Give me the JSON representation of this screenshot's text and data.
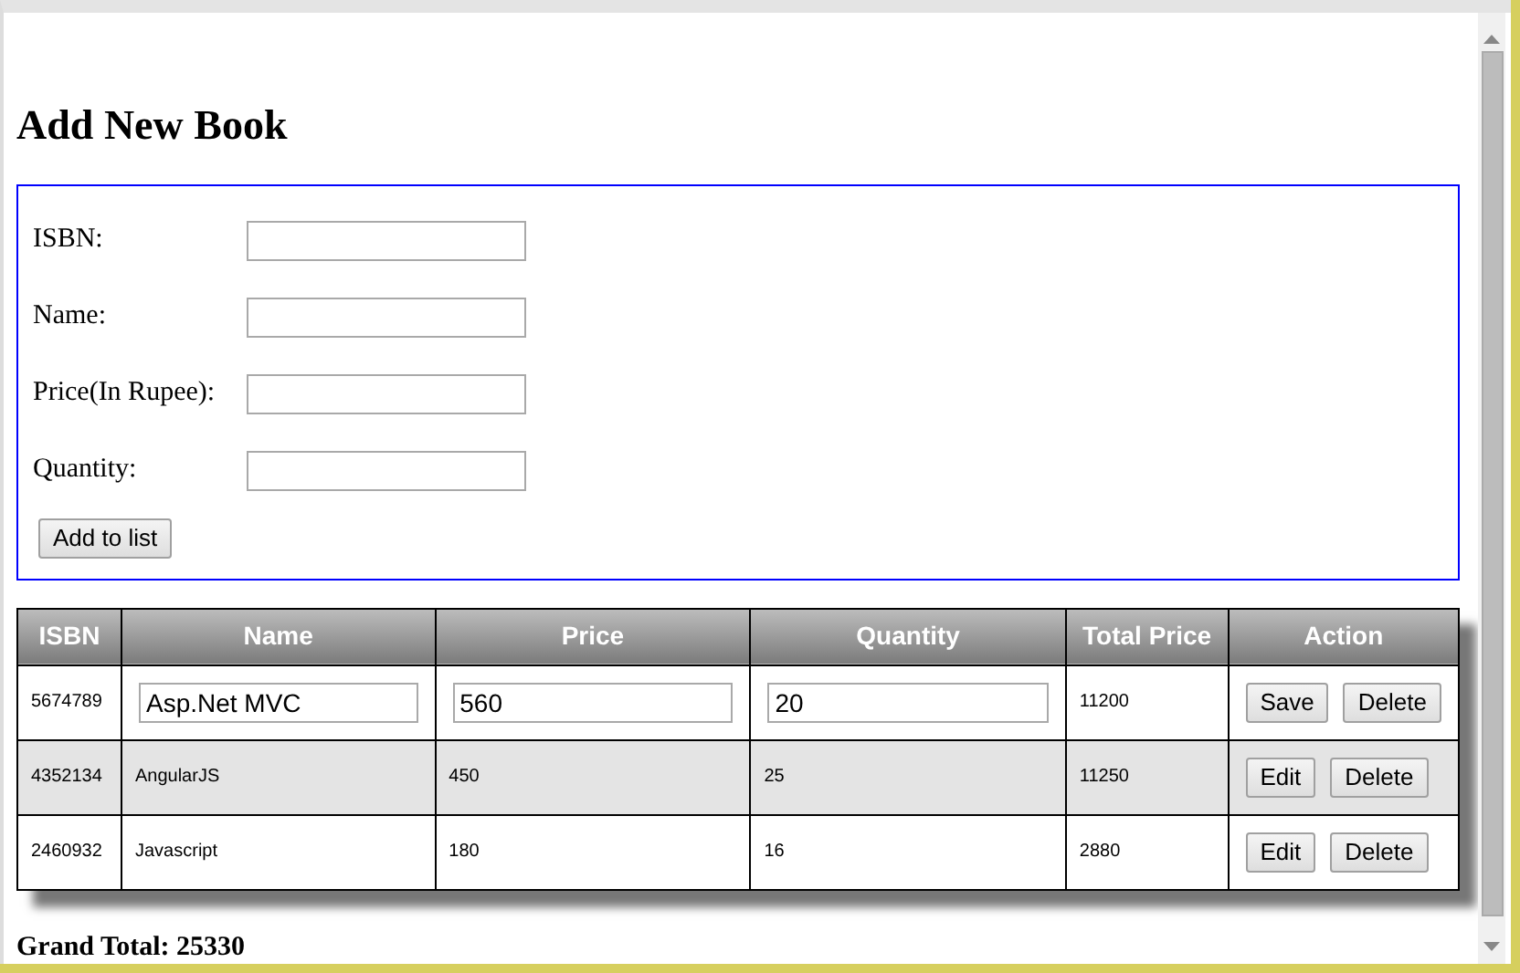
{
  "title": "Add New Book",
  "form": {
    "fields": [
      {
        "label": "ISBN:"
      },
      {
        "label": "Name:"
      },
      {
        "label": "Price(In Rupee):"
      },
      {
        "label": "Quantity:"
      }
    ],
    "button": "Add to list"
  },
  "table": {
    "columns": [
      "ISBN",
      "Name",
      "Price",
      "Quantity",
      "Total Price",
      "Action"
    ],
    "rows": [
      {
        "isbn": "5674789",
        "name": "Asp.Net MVC",
        "price": "560",
        "quantity": "20",
        "total": "11200",
        "editing": true,
        "buttons": [
          "Save",
          "Delete"
        ]
      },
      {
        "isbn": "4352134",
        "name": "AngularJS",
        "price": "450",
        "quantity": "25",
        "total": "11250",
        "editing": false,
        "buttons": [
          "Edit",
          "Delete"
        ]
      },
      {
        "isbn": "2460932",
        "name": "Javascript",
        "price": "180",
        "quantity": "16",
        "total": "2880",
        "editing": false,
        "buttons": [
          "Edit",
          "Delete"
        ]
      }
    ]
  },
  "grand_total": "Grand Total: 25330"
}
